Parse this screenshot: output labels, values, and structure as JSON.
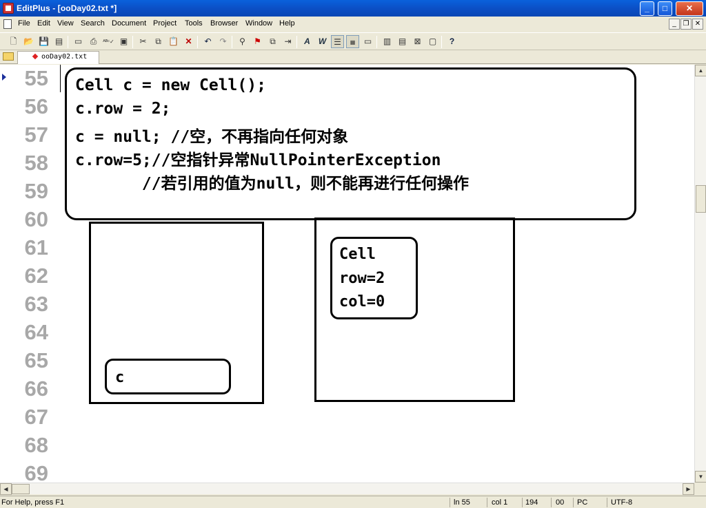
{
  "window": {
    "title": "EditPlus - [ooDay02.txt *]",
    "buttons": [
      "minimize",
      "maximize",
      "close"
    ]
  },
  "menu": {
    "items": [
      "File",
      "Edit",
      "View",
      "Search",
      "Document",
      "Project",
      "Tools",
      "Browser",
      "Window",
      "Help"
    ]
  },
  "toolbar": {
    "icons": [
      "new-file-icon",
      "open-file-icon",
      "save-icon",
      "save-all-icon",
      "print-preview-icon",
      "print-icon",
      "spell-check-icon",
      "browser-preview-icon",
      "cut-icon",
      "copy-icon",
      "paste-icon",
      "delete-icon",
      "undo-icon",
      "redo-icon",
      "find-icon",
      "replace-icon",
      "find-next-icon",
      "goto-icon",
      "font-icon",
      "word-wrap-icon",
      "line-number-icon",
      "column-marker-icon",
      "ruler-icon",
      "directory-window-icon",
      "cliptext-window-icon",
      "output-window-icon",
      "user-tool-icon",
      "help-icon"
    ]
  },
  "tab": {
    "filename": "ooDay02.txt"
  },
  "editor": {
    "line_numbers": [
      "55",
      "56",
      "57",
      "58",
      "59",
      "60",
      "61",
      "62",
      "63",
      "64",
      "65",
      "66",
      "67",
      "68",
      "69"
    ],
    "code_lines": [
      "Cell c = new Cell();",
      "c.row = 2;",
      "c = null; //空，不再指向任何对象",
      "c.row=5;//空指针异常NullPointerException",
      "       //若引用的值为null，则不能再进行任何操作"
    ]
  },
  "diagram": {
    "stack_var": "c",
    "heap_object": [
      "Cell",
      "row=2",
      "col=0"
    ]
  },
  "status": {
    "help": "For Help, press F1",
    "line": "ln 55",
    "col": "col 1",
    "chars": "194",
    "code": "00",
    "mode": "PC",
    "encoding": "UTF-8"
  }
}
